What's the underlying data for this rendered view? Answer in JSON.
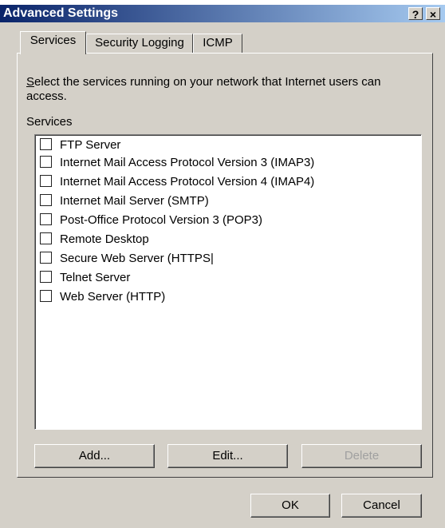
{
  "window": {
    "title": "Advanced Settings",
    "help_glyph": "?",
    "close_glyph": "×"
  },
  "tabs": [
    {
      "label": "Services",
      "active": true
    },
    {
      "label": "Security Logging",
      "active": false
    },
    {
      "label": "ICMP",
      "active": false
    }
  ],
  "description": {
    "first_letter": "S",
    "rest": "elect the services running on your network that Internet users can access."
  },
  "services_label": "Services",
  "services": [
    {
      "label": "FTP Server",
      "checked": false
    },
    {
      "label": "Internet Mail Access Protocol Version 3 (IMAP3)",
      "checked": false
    },
    {
      "label": "Internet Mail Access Protocol Version 4 (IMAP4)",
      "checked": false
    },
    {
      "label": "Internet Mail Server (SMTP)",
      "checked": false
    },
    {
      "label": "Post-Office Protocol Version 3 (POP3)",
      "checked": false
    },
    {
      "label": "Remote Desktop",
      "checked": false
    },
    {
      "label": "Secure Web Server (HTTPS|",
      "checked": false
    },
    {
      "label": "Telnet Server",
      "checked": false
    },
    {
      "label": "Web Server (HTTP)",
      "checked": false
    }
  ],
  "buttons": {
    "add": "Add...",
    "edit": "Edit...",
    "delete": "Delete",
    "delete_disabled": true,
    "ok": "OK",
    "cancel": "Cancel"
  },
  "colors": {
    "titlebar_start": "#0a246a",
    "titlebar_end": "#a6caf0",
    "dialog_face": "#d4d0c8"
  }
}
